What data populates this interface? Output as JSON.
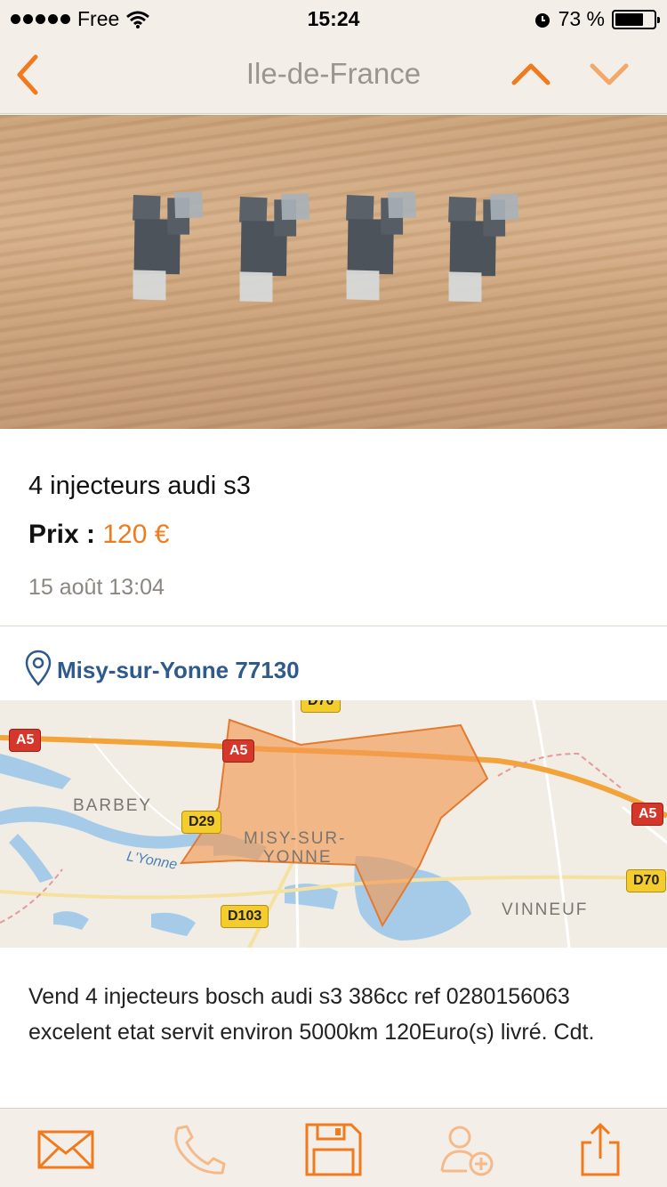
{
  "status_bar": {
    "carrier": "Free",
    "time": "15:24",
    "battery_text": "73 %",
    "battery_level": 0.73
  },
  "nav": {
    "title": "Ile-de-France",
    "back_icon": "chevron-left-icon",
    "prev_icon": "chevron-up-icon",
    "next_icon": "chevron-down-icon"
  },
  "listing": {
    "title": "4 injecteurs audi s3",
    "price_label": "Prix :",
    "price_value": "120 €",
    "date": "15 août 13:04",
    "location": "Misy-sur-Yonne 77130",
    "description": "Vend 4 injecteurs bosch audi s3 386cc ref 0280156063 excelent etat servit environ 5000km 120Euro(s) livré. Cdt."
  },
  "map": {
    "labels": {
      "barbey": "BARBEY",
      "misy_line1": "MISY-SUR-",
      "misy_line2": "YONNE",
      "vinneuf": "VINNEUF",
      "river": "L'Yonne"
    },
    "roads": {
      "a5_left": "A5",
      "a5_mid": "A5",
      "a5_right": "A5",
      "d29": "D29",
      "d103": "D103",
      "d70_right": "D70",
      "d70_top": "D70"
    }
  },
  "toolbar": {
    "items": [
      {
        "icon": "envelope-icon"
      },
      {
        "icon": "phone-icon"
      },
      {
        "icon": "save-icon"
      },
      {
        "icon": "add-contact-icon"
      },
      {
        "icon": "share-icon"
      }
    ]
  },
  "colors": {
    "accent": "#f07a1c",
    "link": "#2e5a8c",
    "bar_bg": "#f3eee8"
  }
}
